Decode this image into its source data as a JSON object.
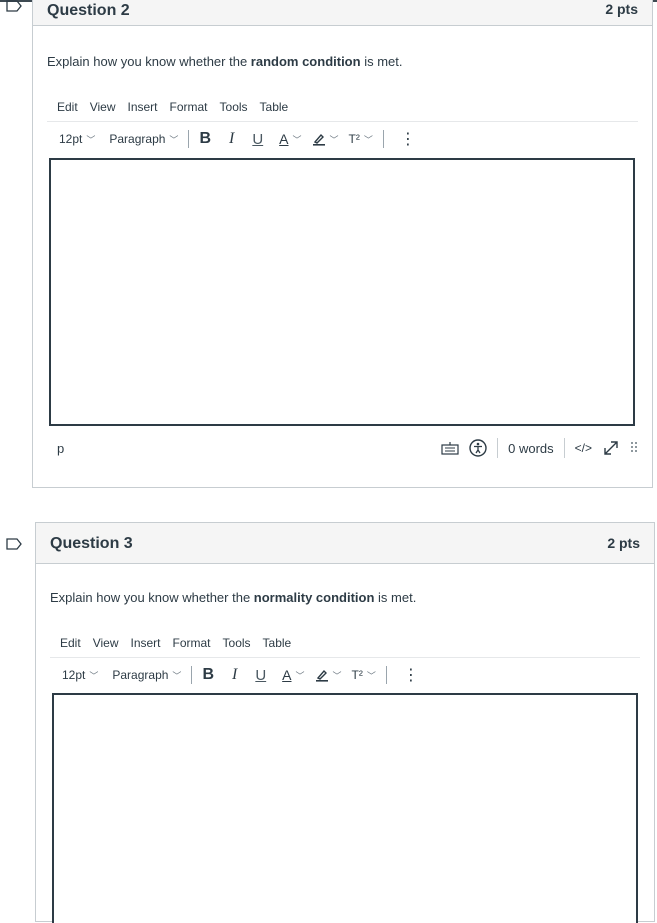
{
  "questions": [
    {
      "title": "Question 2",
      "points": "2 pts",
      "prompt": {
        "before": "Explain how you know whether the ",
        "bold": "random condition",
        "after": " is met."
      },
      "menu": [
        "Edit",
        "View",
        "Insert",
        "Format",
        "Tools",
        "Table"
      ],
      "font_size": "12pt",
      "block_format": "Paragraph",
      "status_path": "p",
      "word_count": "0 words",
      "html_toggle": "</>"
    },
    {
      "title": "Question 3",
      "points": "2 pts",
      "prompt": {
        "before": "Explain how you know whether the ",
        "bold": "normality condition",
        "after": " is met."
      },
      "menu": [
        "Edit",
        "View",
        "Insert",
        "Format",
        "Tools",
        "Table"
      ],
      "font_size": "12pt",
      "block_format": "Paragraph"
    }
  ],
  "toolbar_glyphs": {
    "bold": "B",
    "italic": "I",
    "underline": "U",
    "text_color": "A",
    "superscript": "T²",
    "more": "⋮"
  },
  "colors": {
    "text": "#2d3b45",
    "border": "#c7cdd1",
    "header_bg": "#f5f5f5",
    "icon": "#2d3b45"
  }
}
